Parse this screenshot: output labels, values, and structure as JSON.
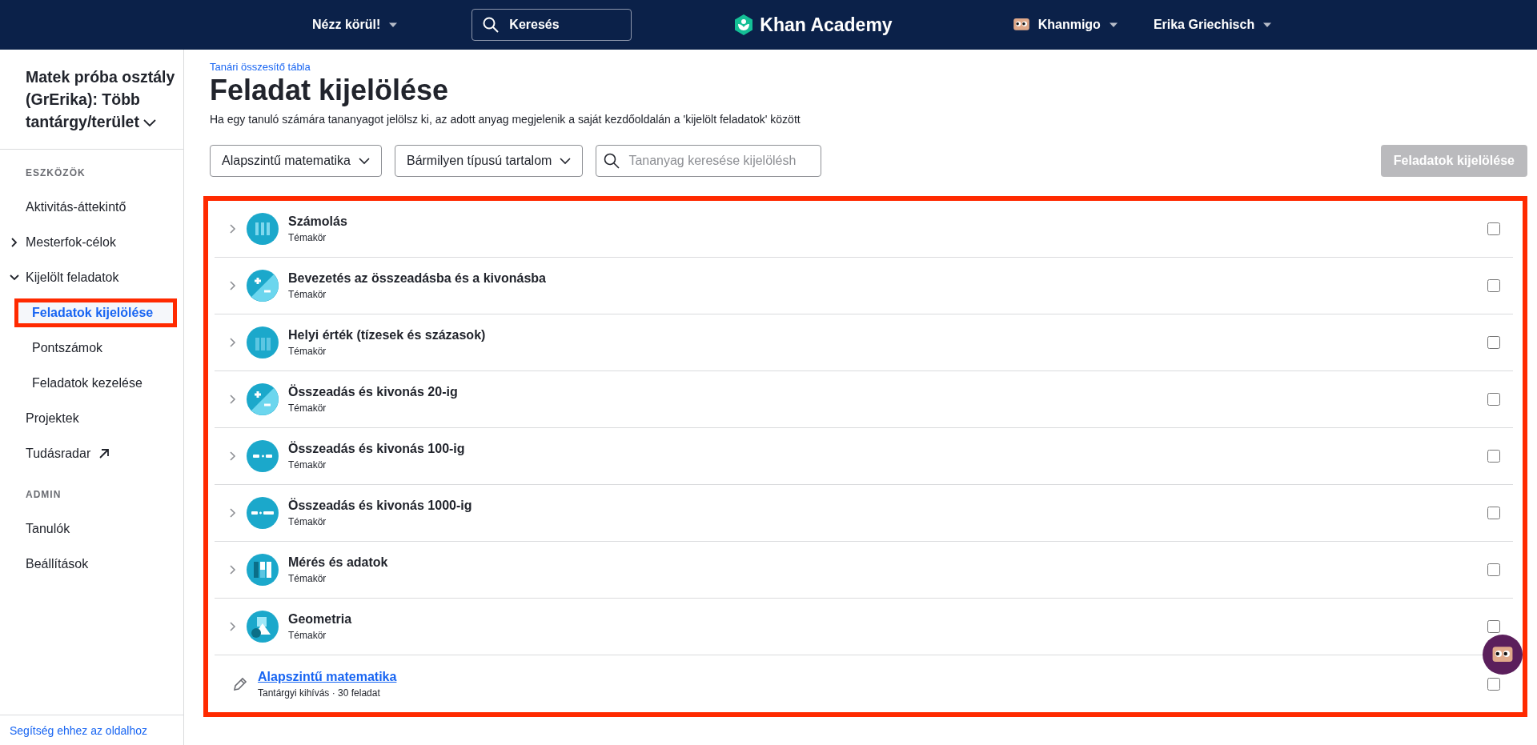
{
  "header": {
    "explore": "Nézz körül!",
    "search": {
      "placeholder": "Keresés"
    },
    "logo": "Khan Academy",
    "khanmigo": "Khanmigo",
    "user": "Erika Griechisch"
  },
  "sidebar": {
    "class_name": "Matek próba osztály (GrErika): Több tantárgy/terület",
    "sections": [
      {
        "heading": "ESZKÖZÖK",
        "items": [
          {
            "label": "Aktivitás-áttekintő",
            "kind": "link",
            "selected": false
          },
          {
            "label": "Mesterfok-célok",
            "kind": "group",
            "expanded": false,
            "selected": false
          },
          {
            "label": "Kijelölt feladatok",
            "kind": "group",
            "expanded": true,
            "selected": false,
            "children": [
              {
                "label": "Feladatok kijelölése",
                "kind": "link",
                "selected": true,
                "highlighted": true
              },
              {
                "label": "Pontszámok",
                "kind": "link",
                "selected": false
              },
              {
                "label": "Feladatok kezelése",
                "kind": "link",
                "selected": false
              }
            ]
          },
          {
            "label": "Projektek",
            "kind": "link",
            "selected": false
          },
          {
            "label": "Tudásradar",
            "kind": "external",
            "selected": false
          }
        ]
      },
      {
        "heading": "ADMIN",
        "items": [
          {
            "label": "Tanulók",
            "kind": "link",
            "selected": false
          },
          {
            "label": "Beállítások",
            "kind": "link",
            "selected": false
          }
        ]
      }
    ],
    "help_link": "Segítség ehhez az oldalhoz"
  },
  "breadcrumb": "Tanári összesítő tábla",
  "title": "Feladat kijelölése",
  "description": "Ha egy tanuló számára tananyagot jelölsz ki, az adott anyag megjelenik a saját kezdőoldalán a 'kijelölt feladatok' között",
  "filters": {
    "course": "Alapszintű matematika",
    "content_type": "Bármilyen típusú tartalom",
    "search": {
      "placeholder": "Tananyag keresése kijelölésh"
    },
    "assign_button": {
      "label": "Feladatok kijelölése",
      "disabled": true
    }
  },
  "content_list": {
    "highlighted": true,
    "rows": [
      {
        "kind": "topic",
        "title": "Számolás",
        "subtitle": "Témakör",
        "expanded": false,
        "checked": false
      },
      {
        "kind": "topic",
        "title": "Bevezetés az összeadásba és a kivonásba",
        "subtitle": "Témakör",
        "expanded": false,
        "checked": false
      },
      {
        "kind": "topic",
        "title": "Helyi érték (tízesek és százasok)",
        "subtitle": "Témakör",
        "expanded": false,
        "checked": false
      },
      {
        "kind": "topic",
        "title": "Összeadás és kivonás 20-ig",
        "subtitle": "Témakör",
        "expanded": false,
        "checked": false
      },
      {
        "kind": "topic",
        "title": "Összeadás és kivonás 100-ig",
        "subtitle": "Témakör",
        "expanded": false,
        "checked": false
      },
      {
        "kind": "topic",
        "title": "Összeadás és kivonás 1000-ig",
        "subtitle": "Témakör",
        "expanded": false,
        "checked": false
      },
      {
        "kind": "topic",
        "title": "Mérés és adatok",
        "subtitle": "Témakör",
        "expanded": false,
        "checked": false
      },
      {
        "kind": "topic",
        "title": "Geometria",
        "subtitle": "Témakör",
        "expanded": false,
        "checked": false
      },
      {
        "kind": "challenge",
        "title": "Alapszintű matematika",
        "subtitle": "Tantárgyi kihívás · 30 feladat",
        "checked": false
      }
    ]
  }
}
